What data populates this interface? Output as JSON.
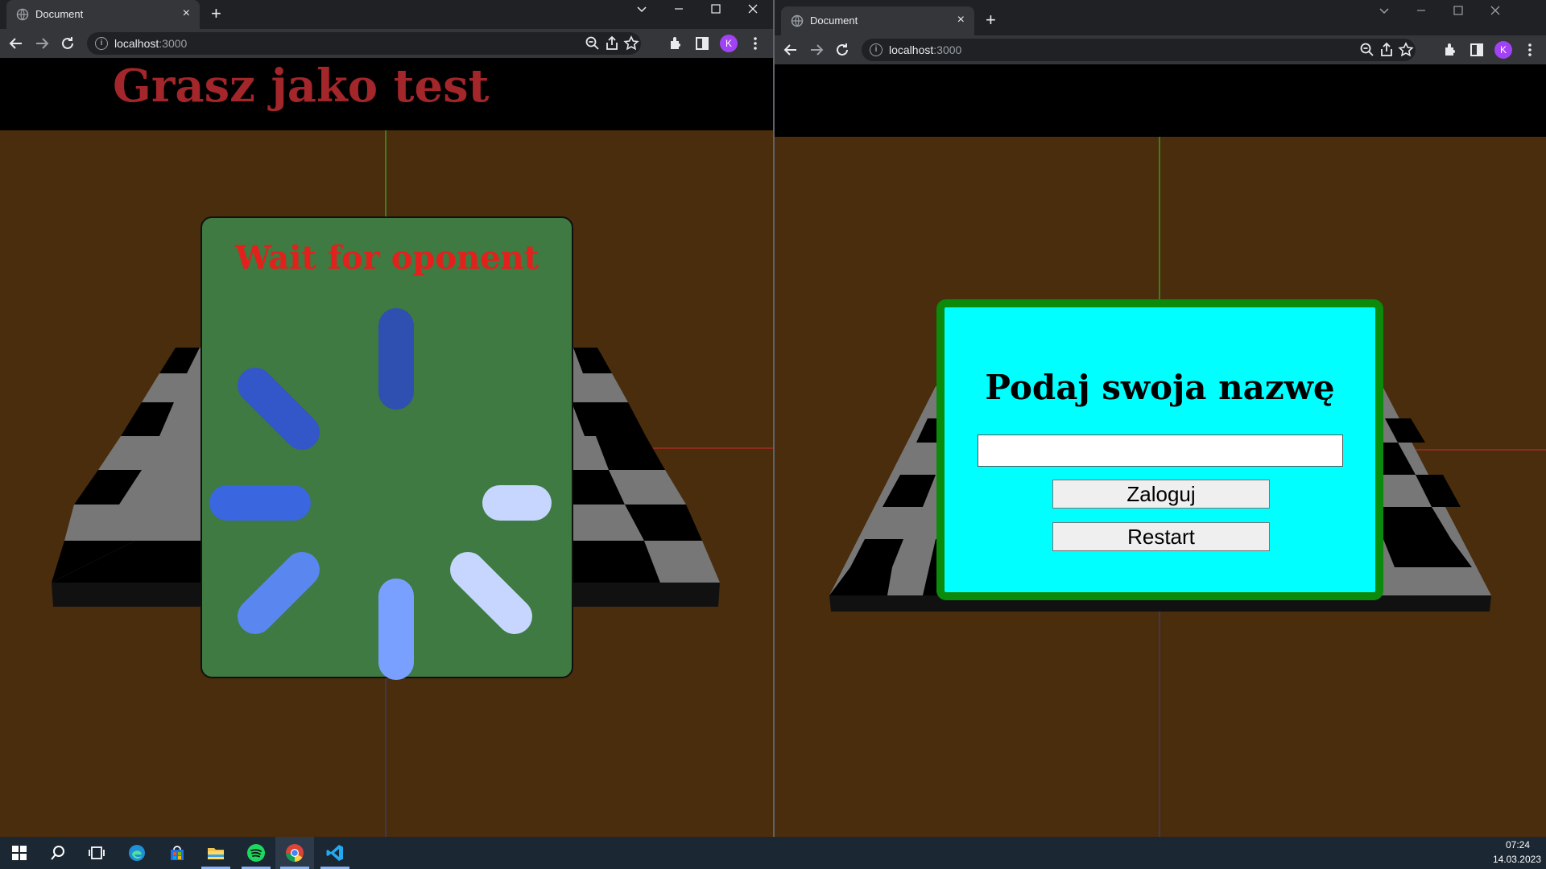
{
  "left_window": {
    "tab_title": "Document",
    "tab_close": "×",
    "new_tab": "+",
    "url_host": "localhost",
    "url_port": ":3000",
    "profile_initial": "K",
    "page": {
      "player_title": "Grasz jako test",
      "wait_title": "Wait for oponent"
    }
  },
  "right_window": {
    "tab_title": "Document",
    "tab_close": "×",
    "new_tab": "+",
    "url_host": "localhost",
    "url_port": ":3000",
    "profile_initial": "K",
    "page": {
      "login_title": "Podaj swoja nazwę",
      "name_input_value": "",
      "login_button": "Zaloguj",
      "restart_button": "Restart"
    }
  },
  "colors": {
    "page_background": "#4a2d0c",
    "wait_panel": "#3e7a41",
    "player_title": "#a3262a",
    "wait_title": "#e3201c",
    "login_panel": "#00ffff",
    "login_border": "#0b8a0b"
  },
  "taskbar": {
    "apps": [
      "start-icon",
      "search-icon",
      "task-view-icon",
      "edge-icon",
      "store-icon",
      "file-explorer-icon",
      "spotify-icon",
      "chrome-icon",
      "vscode-icon"
    ],
    "time": "07:24",
    "date": "14.03.2023"
  }
}
